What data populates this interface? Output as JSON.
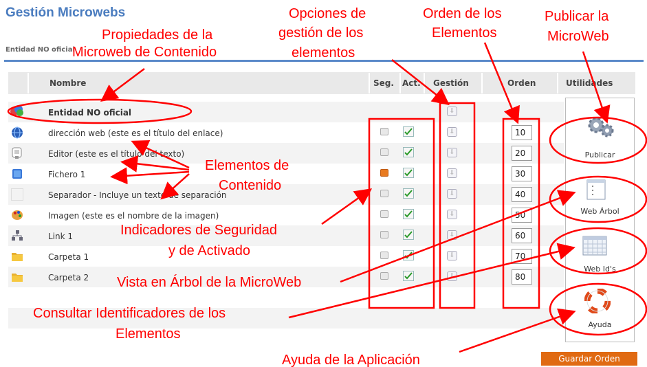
{
  "app": {
    "title": "Gestión Microwebs",
    "breadcrumb": "Entidad NO oficial"
  },
  "table": {
    "columns": {
      "nombre": "Nombre",
      "seg": "Seg.",
      "act": "Act.",
      "gestion": "Gestión",
      "orden": "Orden",
      "utilidades": "Utilidades"
    },
    "header_row": {
      "name": "Entidad NO oficial",
      "icon": "entity-icon"
    },
    "rows": [
      {
        "name": "dirección web (este es el título del enlace)",
        "order": "10",
        "icon": "globe-icon",
        "locked": false
      },
      {
        "name": "Editor (este es el título del texto)",
        "order": "20",
        "icon": "editor-icon",
        "locked": false
      },
      {
        "name": "Fichero 1",
        "order": "30",
        "icon": "file-icon",
        "locked": true
      },
      {
        "name": "Separador - Incluye un texto de separación",
        "order": "40",
        "icon": "separator-icon",
        "locked": false
      },
      {
        "name": "Imagen (este es el nombre de la imagen)",
        "order": "50",
        "icon": "palette-icon",
        "locked": false
      },
      {
        "name": "Link 1",
        "order": "60",
        "icon": "link-icon",
        "locked": false
      },
      {
        "name": "Carpeta 1",
        "order": "70",
        "icon": "folder-icon",
        "locked": false
      },
      {
        "name": "Carpeta 2",
        "order": "80",
        "icon": "folder-icon",
        "locked": false
      }
    ]
  },
  "utilities": {
    "publicar": "Publicar",
    "web_arbol": "Web Árbol",
    "web_ids": "Web Id's",
    "ayuda": "Ayuda"
  },
  "save_button": "Guardar Orden",
  "annotations": {
    "propiedades": [
      "Propiedades de la",
      "Microweb de Contenido"
    ],
    "opciones": [
      "Opciones de",
      "gestión de los",
      "elementos"
    ],
    "orden": [
      "Orden de los",
      "Elementos"
    ],
    "publicar": [
      "Publicar la",
      "MicroWeb"
    ],
    "elementos": [
      "Elementos de",
      "Contenido"
    ],
    "indicadores": [
      "Indicadores de Seguridad",
      "y de Activado"
    ],
    "vista": "Vista en Árbol de la MicroWeb",
    "consultar": [
      "Consultar Identificadores de los",
      "Elementos"
    ],
    "ayuda": "Ayuda de la Aplicación"
  },
  "colors": {
    "annotation": "#ff0000",
    "title": "#4a7cbf",
    "rule": "#5b8ac9",
    "button": "#e06a12"
  }
}
